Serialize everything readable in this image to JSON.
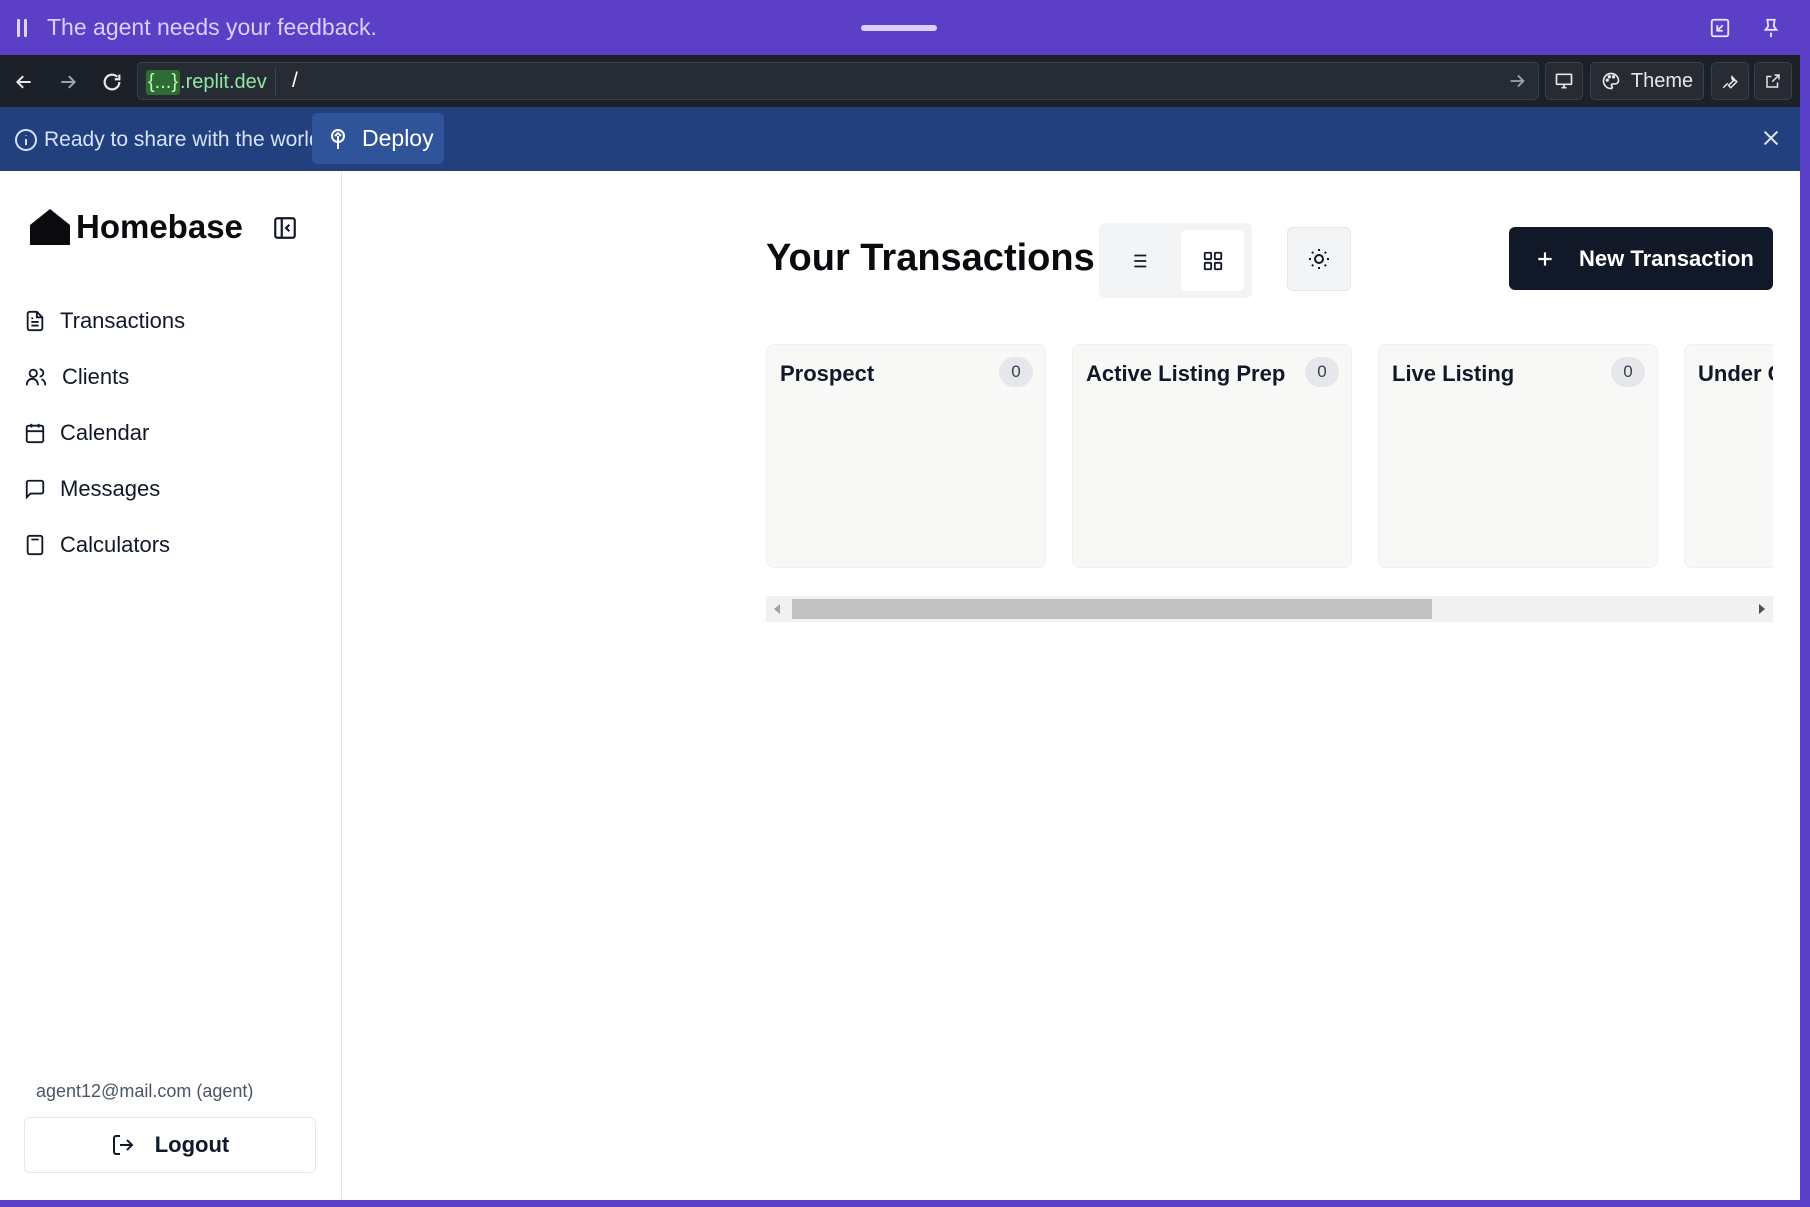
{
  "agent_bar": {
    "message": "The agent needs your feedback."
  },
  "url_bar": {
    "domain_highlight": "{...}",
    "domain_rest": ".replit.dev",
    "path": "/",
    "theme_label": "Theme"
  },
  "banner": {
    "text": "Ready to share with the world?",
    "deploy_label": "Deploy"
  },
  "sidebar": {
    "brand": "Homebase",
    "items": [
      {
        "label": "Transactions",
        "icon": "file-text-icon"
      },
      {
        "label": "Clients",
        "icon": "users-icon"
      },
      {
        "label": "Calendar",
        "icon": "calendar-icon"
      },
      {
        "label": "Messages",
        "icon": "message-square-icon"
      },
      {
        "label": "Calculators",
        "icon": "calculator-icon"
      }
    ],
    "user": "agent12@mail.com (agent)",
    "logout_label": "Logout"
  },
  "main": {
    "title": "Your Transactions",
    "new_button_label": "New Transaction",
    "columns": [
      {
        "title": "Prospect",
        "count": "0"
      },
      {
        "title": "Active Listing Prep",
        "count": "0"
      },
      {
        "title": "Live Listing",
        "count": "0"
      },
      {
        "title": "Under C",
        "count": ""
      }
    ]
  },
  "colors": {
    "agent_bar": "#5b3fc6",
    "banner": "#21407d",
    "primary_button": "#111827"
  }
}
